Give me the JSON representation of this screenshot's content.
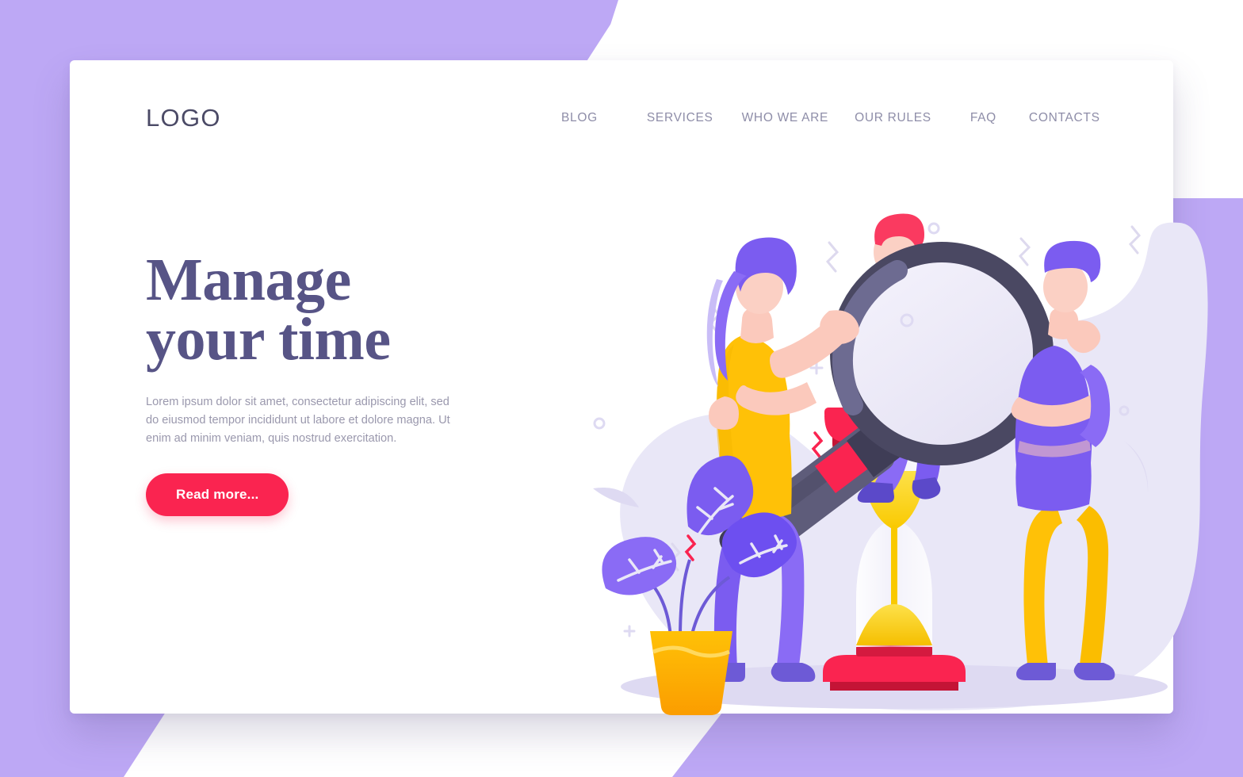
{
  "page": {
    "background_color": "#bda8f5",
    "card_background": "#ffffff"
  },
  "header": {
    "logo": "LOGO",
    "nav": [
      {
        "label": "BLOG",
        "name": "nav-blog"
      },
      {
        "label": "SERVICES",
        "name": "nav-services"
      },
      {
        "label": "WHO WE ARE",
        "name": "nav-who-we-are"
      },
      {
        "label": "OUR RULES",
        "name": "nav-our-rules"
      },
      {
        "label": "FAQ",
        "name": "nav-faq"
      },
      {
        "label": "CONTACTS",
        "name": "nav-contacts"
      }
    ]
  },
  "hero": {
    "title_line1": "Manage",
    "title_line2": "your time",
    "title_color": "#575486",
    "paragraph": "Lorem ipsum dolor sit amet, consectetur adipiscing elit, sed do eiusmod tempor incididunt ut labore et dolore magna. Ut enim ad minim veniam, quis nostrud exercitation.",
    "cta_label": "Read more...",
    "cta_color": "#fa2450"
  },
  "illustration": {
    "name": "time-management-illustration",
    "blob_color": "#e9e7f7",
    "elements": [
      {
        "name": "magnifier",
        "description": "large magnifying glass held by woman"
      },
      {
        "name": "hourglass",
        "description": "red-capped hourglass with yellow sand"
      },
      {
        "name": "woman-with-magnifier",
        "description": "woman with purple hair, yellow top, purple pants"
      },
      {
        "name": "person-on-hourglass",
        "description": "person with red hair, yellow sweater, purple pants, laptop"
      },
      {
        "name": "thinking-man",
        "description": "man in purple shirt and yellow pants in thinking pose"
      },
      {
        "name": "potted-plant",
        "description": "plant with purple leaves in yellow pot"
      }
    ],
    "palette": {
      "yellow": "#ffc107",
      "sand": "#fbd303",
      "red": "#fa2450",
      "purple": "#7b5cf0",
      "dark_navy": "#3f3d56",
      "skin": "#fbc9bc"
    }
  }
}
